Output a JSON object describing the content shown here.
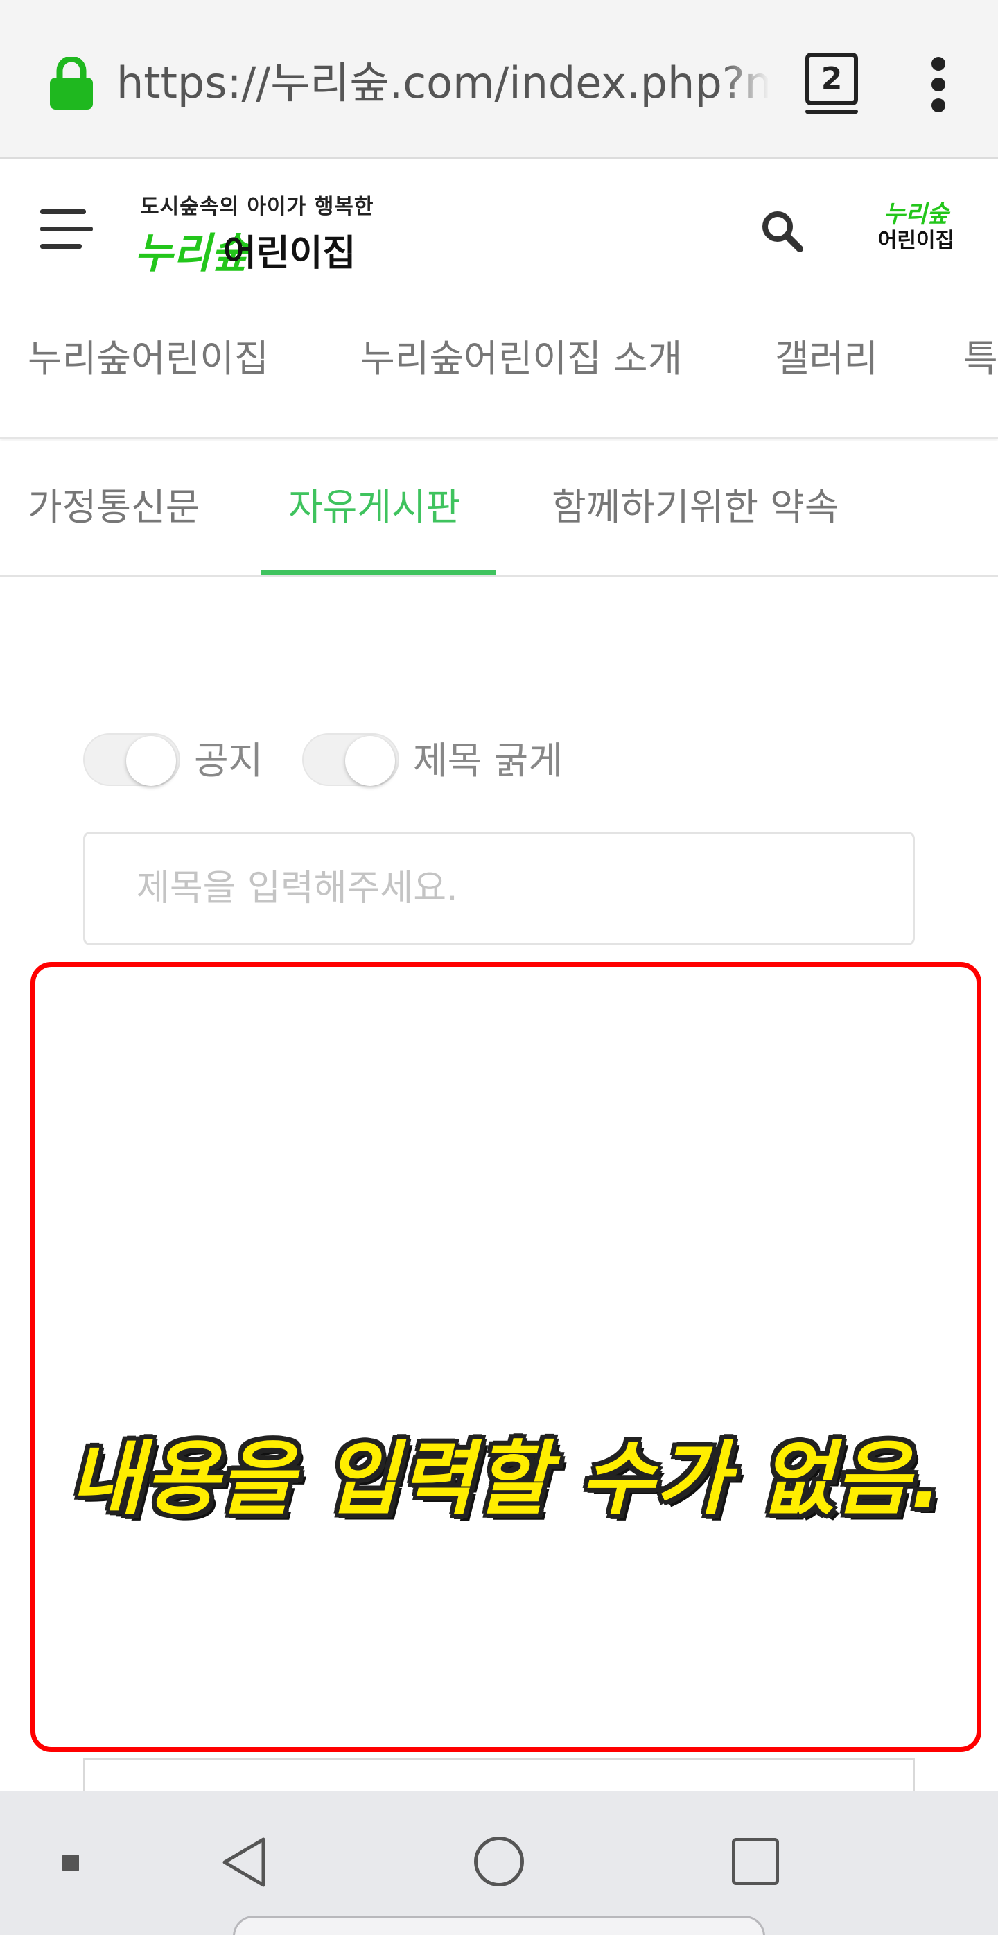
{
  "browser": {
    "url": "https://누리숲.com/index.php?mid",
    "tab_count": "2",
    "lock_icon": "lock-icon",
    "menu_icon": "more-vert-icon"
  },
  "header": {
    "logo_tagline": "도시숲속의 아이가 행복한",
    "logo_green": "누리숲",
    "logo_dark": "어린이집",
    "small_logo_green": "누리숲",
    "small_logo_dark": "어린이집",
    "menu_icon": "hamburger-icon",
    "search_icon": "search-icon"
  },
  "nav_primary": {
    "items": [
      "누리숲어린이집",
      "누리숲어린이집 소개",
      "갤러리",
      "특"
    ]
  },
  "nav_secondary": {
    "tabs": [
      "가정통신문",
      "자유게시판",
      "함께하기위한 약속"
    ],
    "active_index": 1
  },
  "form": {
    "notice_label": "공지",
    "notice_on": false,
    "bold_title_label": "제목 굵게",
    "bold_title_on": false,
    "title_placeholder": "제목을 입력해주세요.",
    "title_value": ""
  },
  "annotation": {
    "message": "내용을 입력할 수가 없음.",
    "highlight_color": "#ff0000",
    "text_color": "#ffee00"
  },
  "colors": {
    "accent": "#3fc35e",
    "lock": "#1fb81f",
    "logo_green": "#23c61b"
  },
  "system_nav": {
    "icons": [
      "dot-icon",
      "back-icon",
      "home-icon",
      "recents-icon"
    ]
  }
}
